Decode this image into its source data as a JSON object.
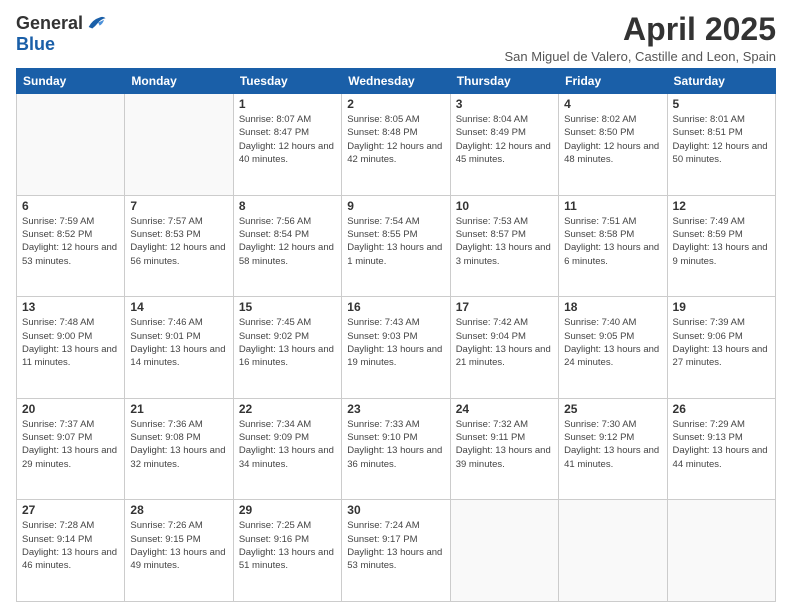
{
  "logo": {
    "general": "General",
    "blue": "Blue"
  },
  "title": "April 2025",
  "subtitle": "San Miguel de Valero, Castille and Leon, Spain",
  "days_of_week": [
    "Sunday",
    "Monday",
    "Tuesday",
    "Wednesday",
    "Thursday",
    "Friday",
    "Saturday"
  ],
  "weeks": [
    [
      {
        "day": "",
        "info": ""
      },
      {
        "day": "",
        "info": ""
      },
      {
        "day": "1",
        "info": "Sunrise: 8:07 AM\nSunset: 8:47 PM\nDaylight: 12 hours and 40 minutes."
      },
      {
        "day": "2",
        "info": "Sunrise: 8:05 AM\nSunset: 8:48 PM\nDaylight: 12 hours and 42 minutes."
      },
      {
        "day": "3",
        "info": "Sunrise: 8:04 AM\nSunset: 8:49 PM\nDaylight: 12 hours and 45 minutes."
      },
      {
        "day": "4",
        "info": "Sunrise: 8:02 AM\nSunset: 8:50 PM\nDaylight: 12 hours and 48 minutes."
      },
      {
        "day": "5",
        "info": "Sunrise: 8:01 AM\nSunset: 8:51 PM\nDaylight: 12 hours and 50 minutes."
      }
    ],
    [
      {
        "day": "6",
        "info": "Sunrise: 7:59 AM\nSunset: 8:52 PM\nDaylight: 12 hours and 53 minutes."
      },
      {
        "day": "7",
        "info": "Sunrise: 7:57 AM\nSunset: 8:53 PM\nDaylight: 12 hours and 56 minutes."
      },
      {
        "day": "8",
        "info": "Sunrise: 7:56 AM\nSunset: 8:54 PM\nDaylight: 12 hours and 58 minutes."
      },
      {
        "day": "9",
        "info": "Sunrise: 7:54 AM\nSunset: 8:55 PM\nDaylight: 13 hours and 1 minute."
      },
      {
        "day": "10",
        "info": "Sunrise: 7:53 AM\nSunset: 8:57 PM\nDaylight: 13 hours and 3 minutes."
      },
      {
        "day": "11",
        "info": "Sunrise: 7:51 AM\nSunset: 8:58 PM\nDaylight: 13 hours and 6 minutes."
      },
      {
        "day": "12",
        "info": "Sunrise: 7:49 AM\nSunset: 8:59 PM\nDaylight: 13 hours and 9 minutes."
      }
    ],
    [
      {
        "day": "13",
        "info": "Sunrise: 7:48 AM\nSunset: 9:00 PM\nDaylight: 13 hours and 11 minutes."
      },
      {
        "day": "14",
        "info": "Sunrise: 7:46 AM\nSunset: 9:01 PM\nDaylight: 13 hours and 14 minutes."
      },
      {
        "day": "15",
        "info": "Sunrise: 7:45 AM\nSunset: 9:02 PM\nDaylight: 13 hours and 16 minutes."
      },
      {
        "day": "16",
        "info": "Sunrise: 7:43 AM\nSunset: 9:03 PM\nDaylight: 13 hours and 19 minutes."
      },
      {
        "day": "17",
        "info": "Sunrise: 7:42 AM\nSunset: 9:04 PM\nDaylight: 13 hours and 21 minutes."
      },
      {
        "day": "18",
        "info": "Sunrise: 7:40 AM\nSunset: 9:05 PM\nDaylight: 13 hours and 24 minutes."
      },
      {
        "day": "19",
        "info": "Sunrise: 7:39 AM\nSunset: 9:06 PM\nDaylight: 13 hours and 27 minutes."
      }
    ],
    [
      {
        "day": "20",
        "info": "Sunrise: 7:37 AM\nSunset: 9:07 PM\nDaylight: 13 hours and 29 minutes."
      },
      {
        "day": "21",
        "info": "Sunrise: 7:36 AM\nSunset: 9:08 PM\nDaylight: 13 hours and 32 minutes."
      },
      {
        "day": "22",
        "info": "Sunrise: 7:34 AM\nSunset: 9:09 PM\nDaylight: 13 hours and 34 minutes."
      },
      {
        "day": "23",
        "info": "Sunrise: 7:33 AM\nSunset: 9:10 PM\nDaylight: 13 hours and 36 minutes."
      },
      {
        "day": "24",
        "info": "Sunrise: 7:32 AM\nSunset: 9:11 PM\nDaylight: 13 hours and 39 minutes."
      },
      {
        "day": "25",
        "info": "Sunrise: 7:30 AM\nSunset: 9:12 PM\nDaylight: 13 hours and 41 minutes."
      },
      {
        "day": "26",
        "info": "Sunrise: 7:29 AM\nSunset: 9:13 PM\nDaylight: 13 hours and 44 minutes."
      }
    ],
    [
      {
        "day": "27",
        "info": "Sunrise: 7:28 AM\nSunset: 9:14 PM\nDaylight: 13 hours and 46 minutes."
      },
      {
        "day": "28",
        "info": "Sunrise: 7:26 AM\nSunset: 9:15 PM\nDaylight: 13 hours and 49 minutes."
      },
      {
        "day": "29",
        "info": "Sunrise: 7:25 AM\nSunset: 9:16 PM\nDaylight: 13 hours and 51 minutes."
      },
      {
        "day": "30",
        "info": "Sunrise: 7:24 AM\nSunset: 9:17 PM\nDaylight: 13 hours and 53 minutes."
      },
      {
        "day": "",
        "info": ""
      },
      {
        "day": "",
        "info": ""
      },
      {
        "day": "",
        "info": ""
      }
    ]
  ]
}
